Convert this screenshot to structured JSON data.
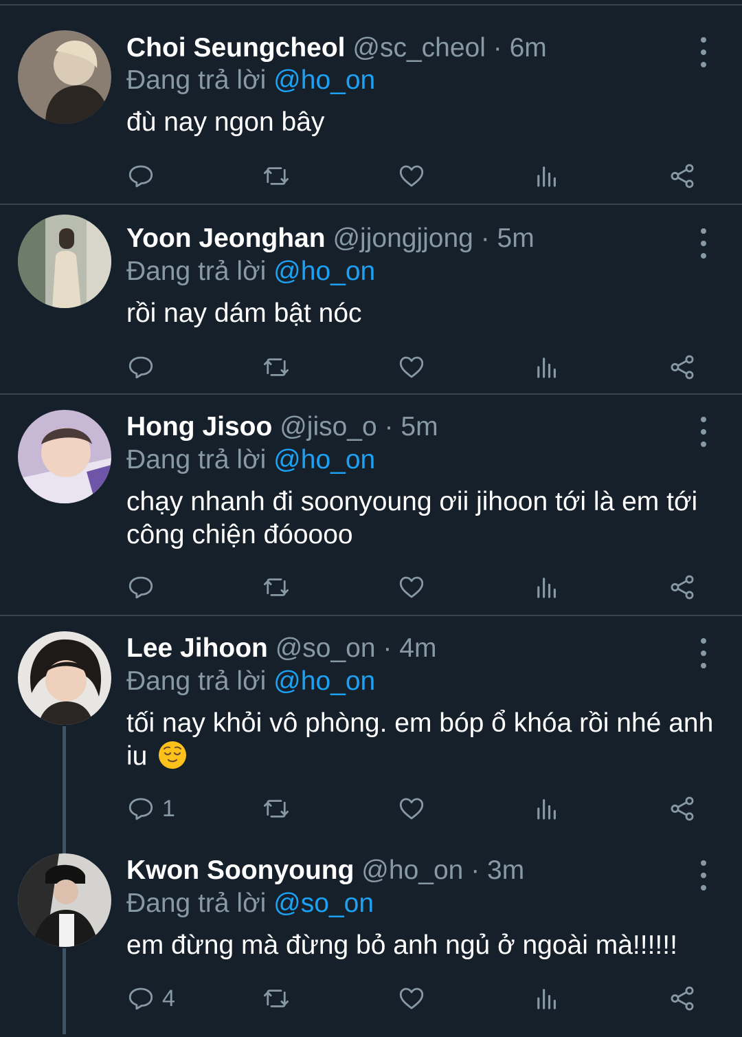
{
  "tweets": [
    {
      "name": "Choi Seungcheol",
      "handle": "@sc_cheol",
      "time": "6m",
      "reply_prefix": "Đang trả lời",
      "reply_to": "@ho_on",
      "text": "đù nay ngon bây",
      "reply_count": ""
    },
    {
      "name": "Yoon Jeonghan",
      "handle": "@jjongjjong",
      "time": "5m",
      "reply_prefix": "Đang trả lời",
      "reply_to": "@ho_on",
      "text": "rồi nay dám bật nóc",
      "reply_count": ""
    },
    {
      "name": "Hong Jisoo",
      "handle": "@jiso_o",
      "time": "5m",
      "reply_prefix": "Đang trả lời",
      "reply_to": "@ho_on",
      "text": "chạy nhanh đi soonyoung ơii jihoon tới là em tới công chiện đóoooo",
      "reply_count": ""
    },
    {
      "name": "Lee Jihoon",
      "handle": "@so_on",
      "time": "4m",
      "reply_prefix": "Đang trả lời",
      "reply_to": "@ho_on",
      "text": "tối nay khỏi vô phòng. em bóp ổ khóa rồi nhé anh iu",
      "reply_count": "1"
    },
    {
      "name": "Kwon Soonyoung",
      "handle": "@ho_on",
      "time": "3m",
      "reply_prefix": "Đang trả lời",
      "reply_to": "@so_on",
      "text": "em đừng mà đừng bỏ anh ngủ ở ngoài mà!!!!!!",
      "reply_count": "4"
    }
  ],
  "separator": "·",
  "icons": {
    "reply": "reply-icon",
    "retweet": "retweet-icon",
    "like": "heart-icon",
    "analytics": "analytics-icon",
    "share": "share-icon",
    "more": "more-icon",
    "emoji": "relieved-face-emoji"
  },
  "colors": {
    "background": "#15202b",
    "divider": "#38444d",
    "secondary_text": "#8899a6",
    "link": "#1da1f2",
    "thread_line": "#3d5466"
  }
}
